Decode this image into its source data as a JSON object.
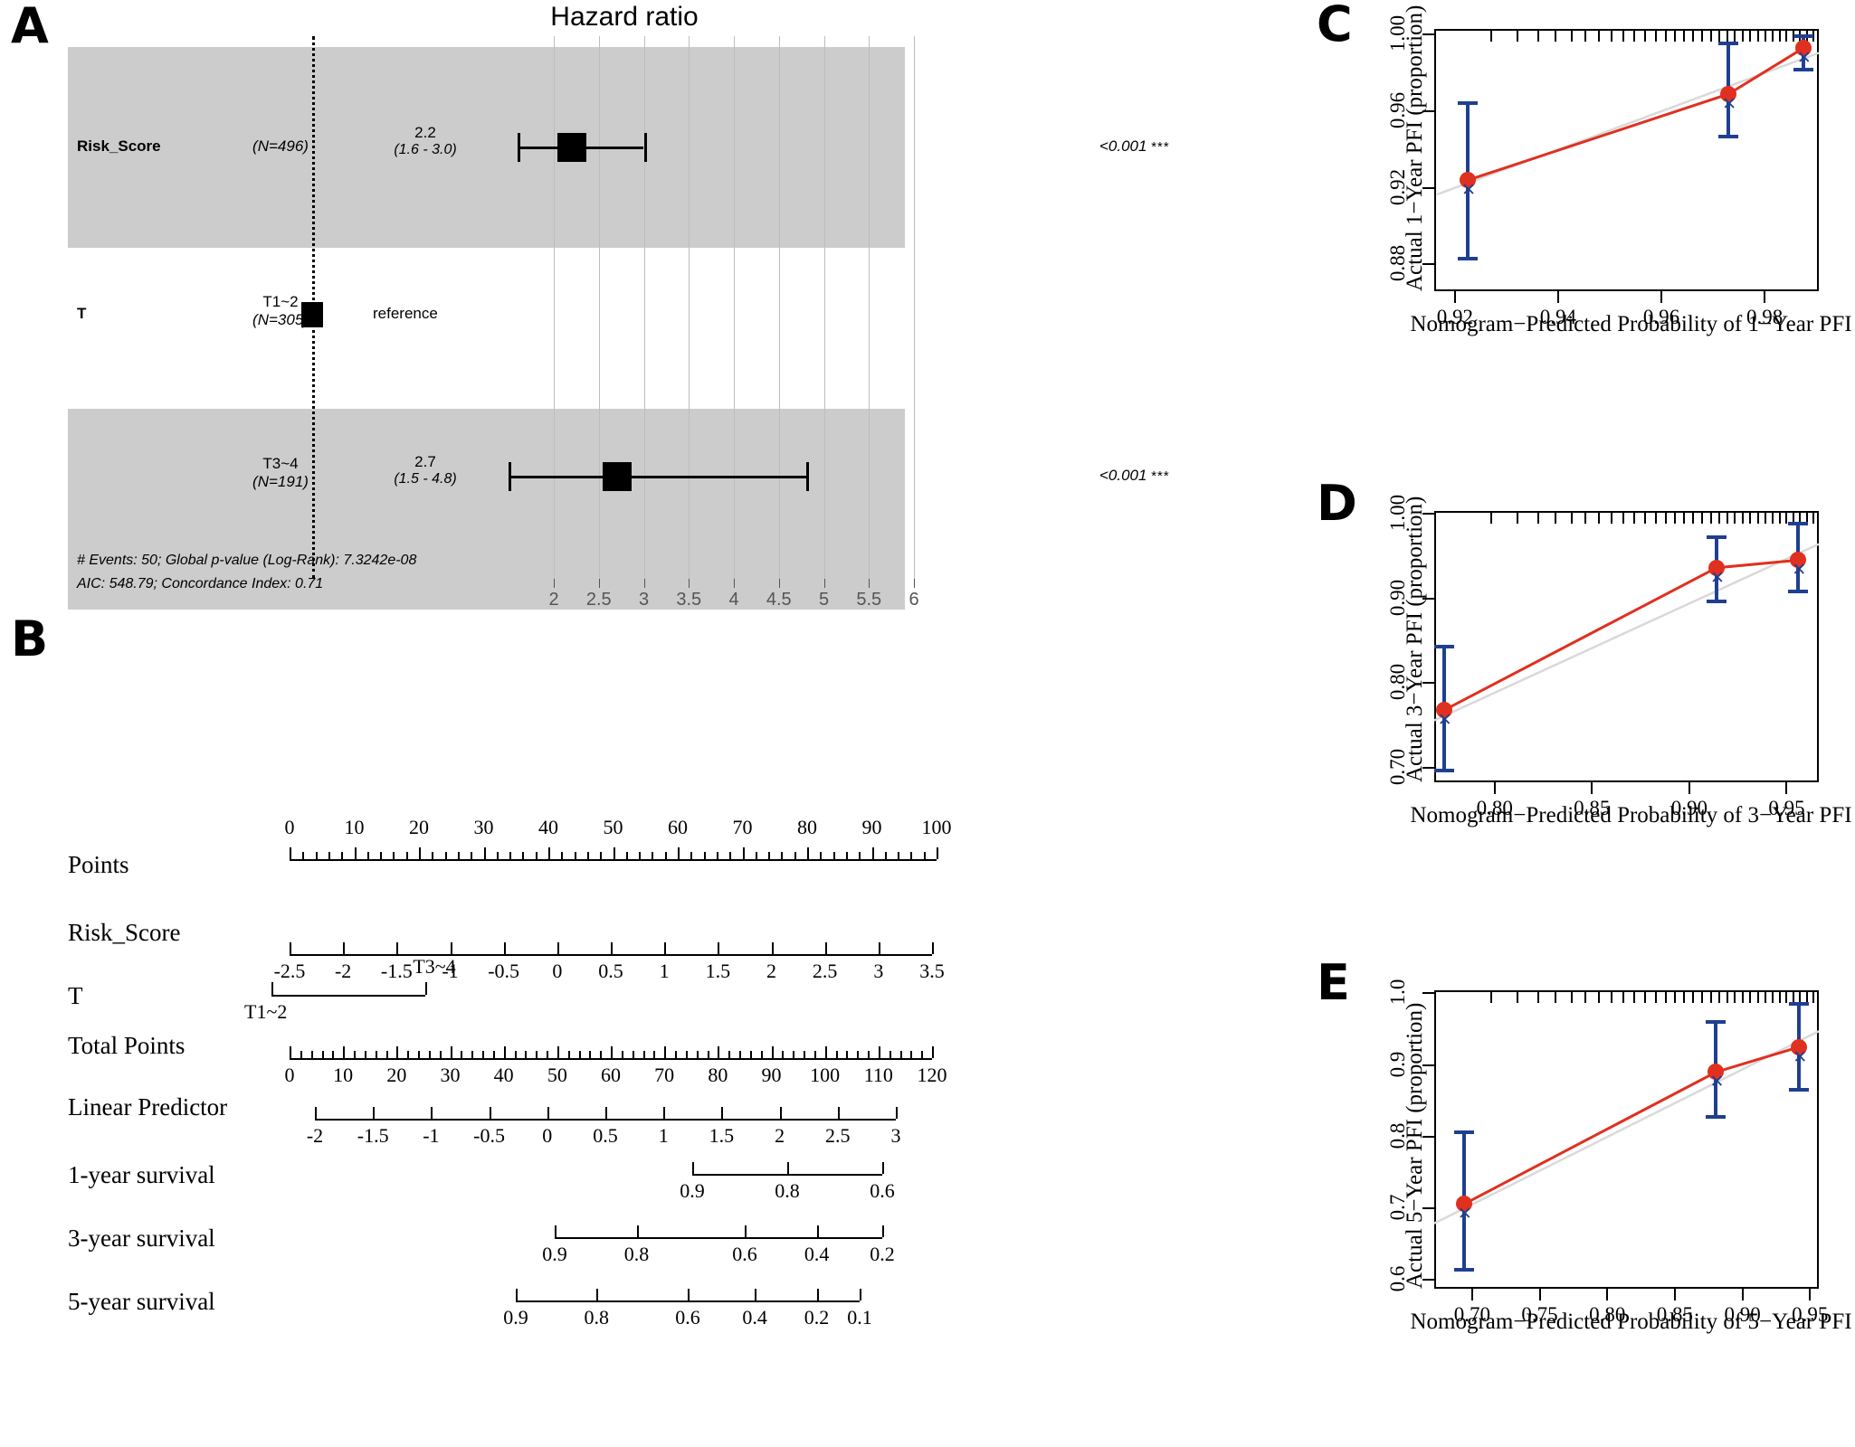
{
  "panels": {
    "a": {
      "letter": "A"
    },
    "b": {
      "letter": "B"
    },
    "c": {
      "letter": "C"
    },
    "d": {
      "letter": "D"
    },
    "e": {
      "letter": "E"
    }
  },
  "forest": {
    "title": "Hazard ratio",
    "rows": [
      {
        "variable": "Risk_Score",
        "level": "",
        "n": "(N=496)",
        "estimate": "2.2",
        "ci": "(1.6 - 3.0)",
        "pvalue": "<0.001",
        "stars": "***",
        "hr": 2.2,
        "lo": 1.6,
        "hi": 3.0,
        "reference": false
      },
      {
        "variable": "T",
        "level": "T1~2",
        "n": "(N=305)",
        "estimate": "",
        "ci": "",
        "pvalue": "",
        "stars": "",
        "hr": 1.0,
        "lo": 1.0,
        "hi": 1.0,
        "reference": true,
        "reference_label": "reference"
      },
      {
        "variable": "",
        "level": "T3~4",
        "n": "(N=191)",
        "estimate": "2.7",
        "ci": "(1.5 - 4.8)",
        "pvalue": "<0.001",
        "stars": "***",
        "hr": 2.7,
        "lo": 1.5,
        "hi": 4.8,
        "reference": false
      }
    ],
    "axis_ticks": [
      "2",
      "2.5",
      "3",
      "3.5",
      "4",
      "4.5",
      "5",
      "5.5",
      "6"
    ],
    "axis_values": [
      2,
      2.5,
      3,
      3.5,
      4,
      4.5,
      5,
      5.5,
      6
    ],
    "footnotes": [
      "# Events: 50; Global p-value (Log-Rank): 7.3242e-08",
      "AIC: 548.79; Concordance Index: 0.71"
    ],
    "band_color": "#cccccc"
  },
  "nomogram": {
    "rows": [
      {
        "label": "Points",
        "ticks": [
          "0",
          "10",
          "20",
          "30",
          "40",
          "50",
          "60",
          "70",
          "80",
          "90",
          "100"
        ],
        "values": [
          0,
          10,
          20,
          30,
          40,
          50,
          60,
          70,
          80,
          90,
          100
        ],
        "numbers_on_top": true,
        "minor_per_gap": 4
      },
      {
        "label": "Risk_Score",
        "ticks": [
          "-2.5",
          "-2",
          "-1.5",
          "-1",
          "-0.5",
          "0",
          "0.5",
          "1",
          "1.5",
          "2",
          "2.5",
          "3",
          "3.5"
        ],
        "values": [
          -2.5,
          -2,
          -1.5,
          -1,
          -0.5,
          0,
          0.5,
          1,
          1.5,
          2,
          2.5,
          3,
          3.5
        ],
        "numbers_on_top": false,
        "minor_per_gap": 0
      },
      {
        "label": "T",
        "categories": [
          {
            "text": "T1~2",
            "pos": 0.0,
            "below": true
          },
          {
            "text": "T3~4",
            "pos": 1.0,
            "below": false
          }
        ]
      },
      {
        "label": "Total Points",
        "ticks": [
          "0",
          "10",
          "20",
          "30",
          "40",
          "50",
          "60",
          "70",
          "80",
          "90",
          "100",
          "110",
          "120"
        ],
        "values": [
          0,
          10,
          20,
          30,
          40,
          50,
          60,
          70,
          80,
          90,
          100,
          110,
          120
        ],
        "numbers_on_top": false,
        "minor_per_gap": 4
      },
      {
        "label": "Linear Predictor",
        "ticks": [
          "-2",
          "-1.5",
          "-1",
          "-0.5",
          "0",
          "0.5",
          "1",
          "1.5",
          "2",
          "2.5",
          "3"
        ],
        "values": [
          -2,
          -1.5,
          -1,
          -0.5,
          0,
          0.5,
          1,
          1.5,
          2,
          2.5,
          3
        ],
        "numbers_on_top": false,
        "minor_per_gap": 0
      },
      {
        "label": "1-year survival",
        "ticks": [
          "0.9",
          "0.8",
          "0.6"
        ],
        "positions": [
          0.0,
          0.5,
          1.0
        ],
        "numbers_on_top": false
      },
      {
        "label": "3-year survival",
        "ticks": [
          "0.9",
          "0.8",
          "0.6",
          "0.4",
          "0.2"
        ],
        "positions": [
          0.0,
          0.25,
          0.58,
          0.8,
          1.0
        ],
        "numbers_on_top": false
      },
      {
        "label": "5-year survival",
        "ticks": [
          "0.9",
          "0.8",
          "0.6",
          "0.4",
          "0.2",
          "0.1"
        ],
        "positions": [
          0.0,
          0.235,
          0.5,
          0.695,
          0.875,
          1.0
        ],
        "numbers_on_top": false
      }
    ]
  },
  "chart_data": [
    {
      "type": "line",
      "panel": "C",
      "title": "",
      "xlabel": "Nomogram−Predicted Probability of 1−Year PFI",
      "ylabel": "Actual 1−Year PFI (proportion)",
      "xlim": [
        0.916,
        0.9905
      ],
      "ylim": [
        0.866,
        1.003
      ],
      "xticks": [
        0.92,
        0.94,
        0.96,
        0.98
      ],
      "xticklabels": [
        "0.92",
        "0.94",
        "0.96",
        "0.98"
      ],
      "yticks": [
        0.88,
        0.92,
        0.96,
        1.0
      ],
      "yticklabels": [
        "0.88",
        "0.92",
        "0.96",
        "1.00"
      ],
      "grid": false,
      "legend": "none",
      "series": [
        {
          "name": "ideal",
          "color": "#d9d9d9",
          "x": [
            0.9165,
            0.9905
          ],
          "y": [
            0.9165,
            0.9905
          ]
        },
        {
          "name": "observed",
          "color": "#e03020",
          "x": [
            0.9225,
            0.973,
            0.9875
          ],
          "y": [
            0.924,
            0.969,
            0.993
          ],
          "ci_lower": [
            0.882,
            0.946,
            0.981
          ],
          "ci_upper": [
            0.965,
            0.9965,
            1.0
          ]
        }
      ]
    },
    {
      "type": "line",
      "panel": "D",
      "title": "",
      "xlabel": "Nomogram−Predicted Probability of 3−Year PFI",
      "ylabel": "Actual 3−Year PFI (proportion)",
      "xlim": [
        0.769,
        0.9665
      ],
      "ylim": [
        0.683,
        1.003
      ],
      "xticks": [
        0.8,
        0.85,
        0.9,
        0.95
      ],
      "xticklabels": [
        "0.80",
        "0.85",
        "0.90",
        "0.95"
      ],
      "yticks": [
        0.7,
        0.8,
        0.9,
        1.0
      ],
      "yticklabels": [
        "0.70",
        "0.80",
        "0.90",
        "1.00"
      ],
      "grid": false,
      "legend": "none",
      "series": [
        {
          "name": "ideal",
          "color": "#d9d9d9",
          "x": [
            0.769,
            0.9665
          ],
          "y": [
            0.756,
            0.964
          ]
        },
        {
          "name": "observed",
          "color": "#e03020",
          "x": [
            0.774,
            0.914,
            0.956
          ],
          "y": [
            0.768,
            0.936,
            0.945
          ],
          "ci_lower": [
            0.695,
            0.894,
            0.906
          ],
          "ci_upper": [
            0.845,
            0.974,
            0.9905
          ]
        }
      ]
    },
    {
      "type": "line",
      "panel": "E",
      "title": "",
      "xlabel": "Nomogram−Predicted Probability of 5−Year PFI",
      "ylabel": "Actual 5−Year PFI (proportion)",
      "xlim": [
        0.672,
        0.9565
      ],
      "ylim": [
        0.588,
        1.004
      ],
      "xticks": [
        0.7,
        0.75,
        0.8,
        0.85,
        0.9,
        0.95
      ],
      "xticklabels": [
        "0.70",
        "0.75",
        "0.80",
        "0.85",
        "0.90",
        "0.95"
      ],
      "yticks": [
        0.6,
        0.7,
        0.8,
        0.9,
        1.0
      ],
      "yticklabels": [
        "0.6",
        "0.7",
        "0.8",
        "0.9",
        "1.0"
      ],
      "grid": false,
      "legend": "none",
      "series": [
        {
          "name": "ideal",
          "color": "#d9d9d9",
          "x": [
            0.672,
            0.9565
          ],
          "y": [
            0.679,
            0.947
          ]
        },
        {
          "name": "observed",
          "color": "#e03020",
          "x": [
            0.694,
            0.8805,
            0.942
          ],
          "y": [
            0.706,
            0.89,
            0.925
          ],
          "ci_lower": [
            0.612,
            0.825,
            0.863
          ],
          "ci_upper": [
            0.809,
            0.963,
            0.988
          ]
        }
      ]
    }
  ]
}
